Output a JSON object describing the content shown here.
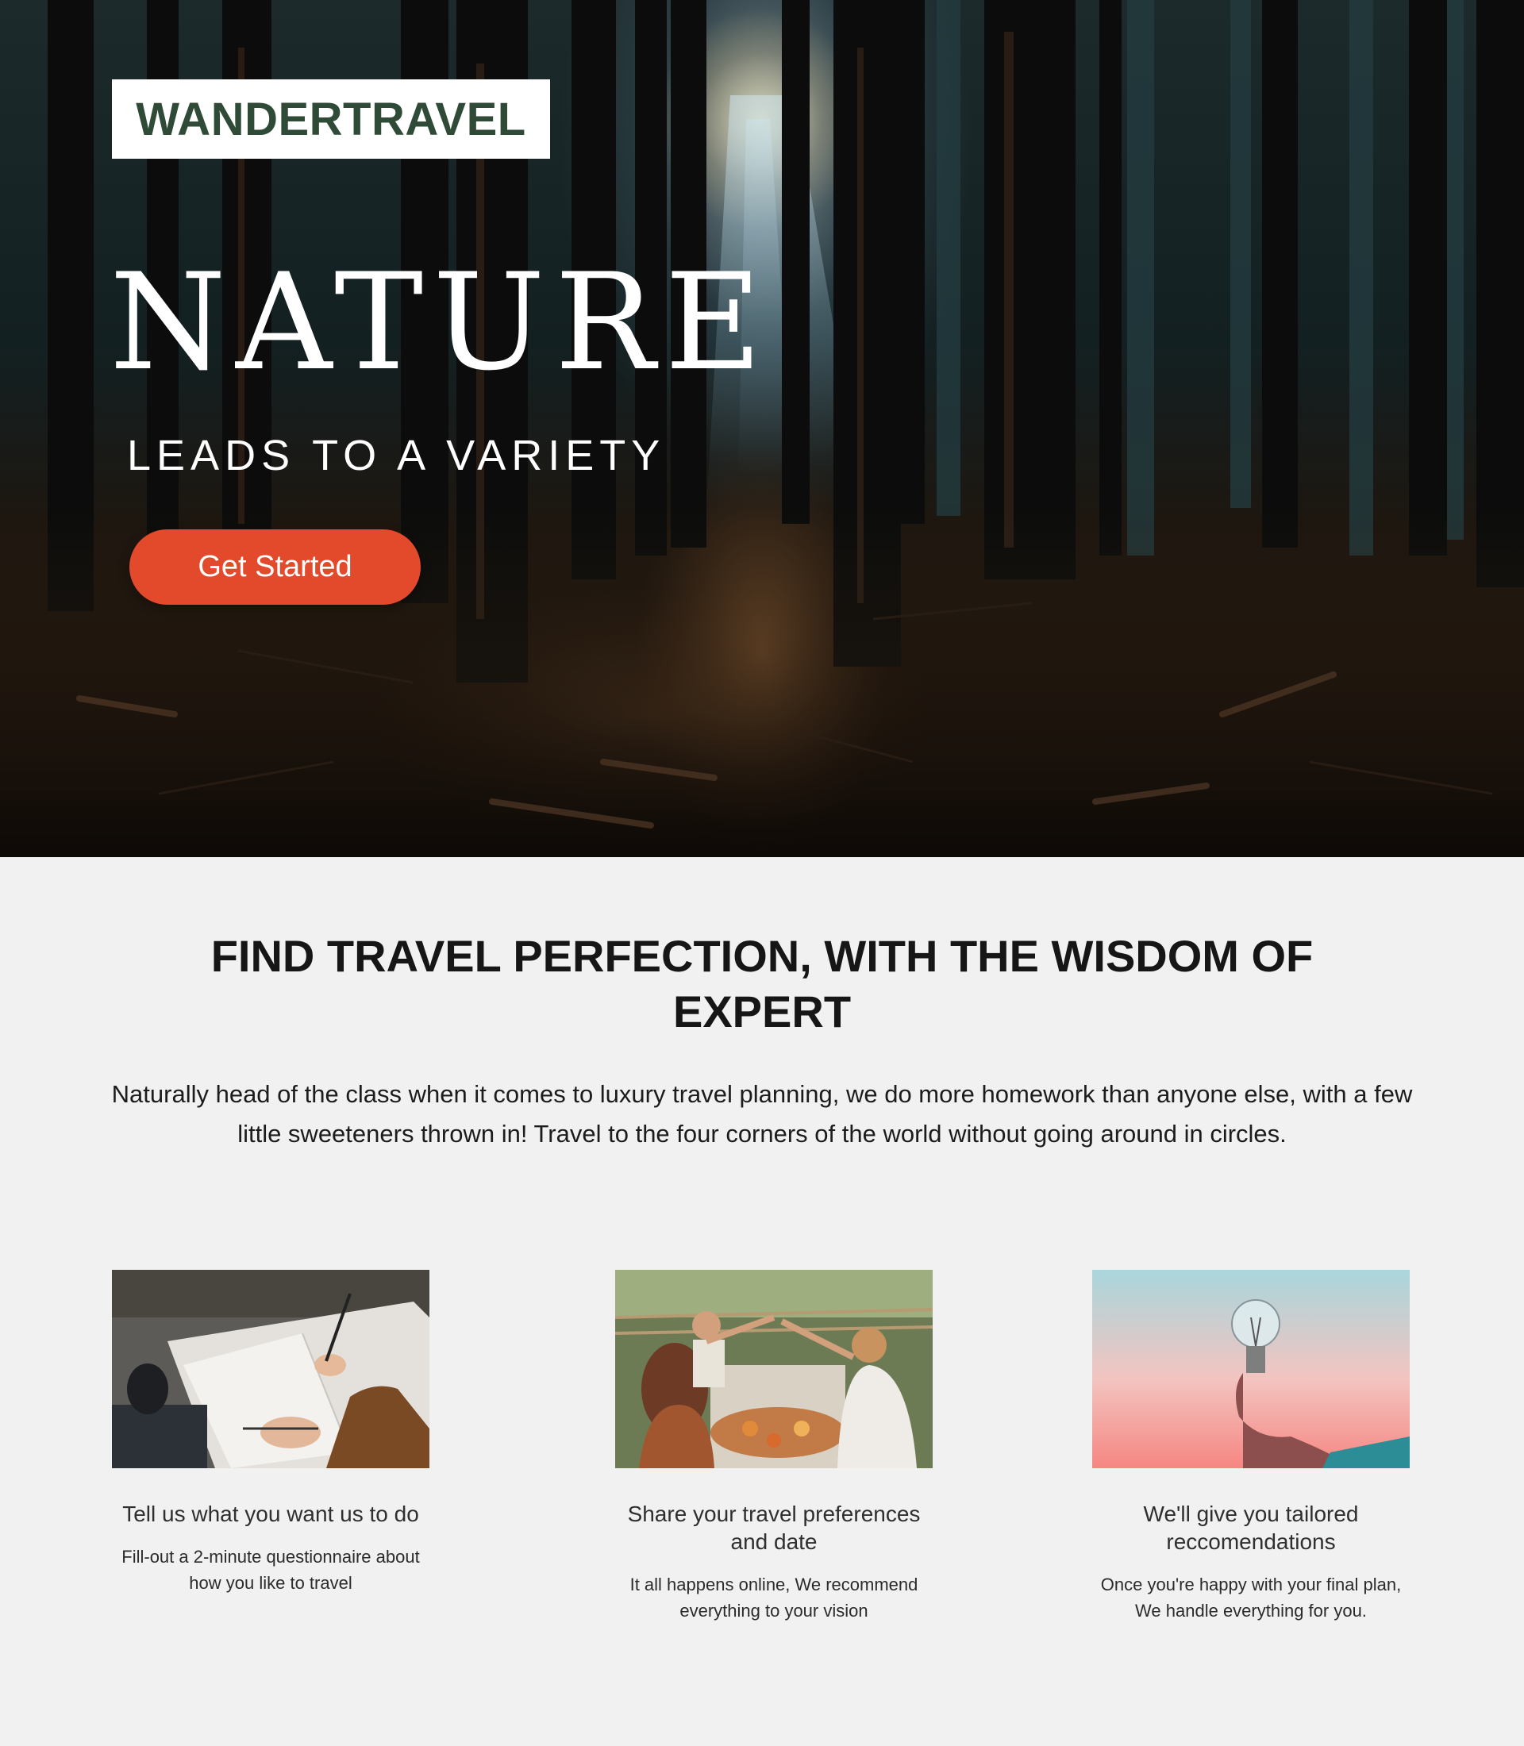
{
  "brand": {
    "logo_text": "WANDERTRAVEL"
  },
  "hero": {
    "title": "NATURE",
    "subtitle": "LEADS TO A VARIETY",
    "cta_label": "Get Started",
    "accent_color": "#e34a2b",
    "logo_color": "#2f4a36"
  },
  "intro": {
    "heading": "FIND TRAVEL PERFECTION, WITH THE WISDOM OF EXPERT",
    "body": "Naturally head of the class when it comes to luxury travel planning, we do more homework than anyone else, with a few little sweeteners thrown in! Travel to the four corners of the world without going around in circles."
  },
  "features": [
    {
      "title": "Tell us what you want us to do",
      "description": "Fill-out a 2-minute questionnaire about how you like to travel",
      "icon": "writing-notebook-photo"
    },
    {
      "title": "Share your travel preferences and date",
      "description": "It all happens online, We recommend everything to your vision",
      "icon": "friends-dinner-photo"
    },
    {
      "title": "We'll give you tailored reccomendations",
      "description": "Once you're happy with your final plan, We handle everything for you.",
      "icon": "lightbulb-photo"
    }
  ]
}
